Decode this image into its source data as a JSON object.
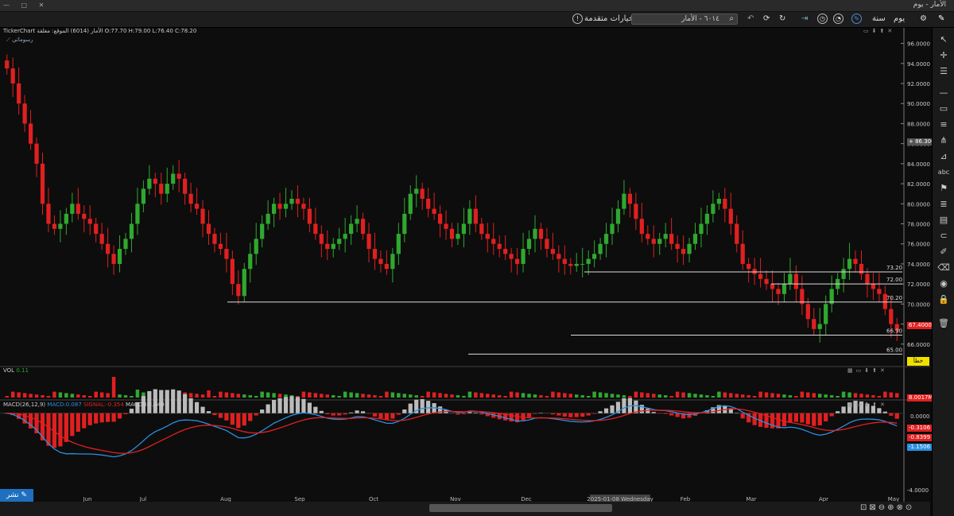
{
  "window": {
    "title": "الأمار - يوم"
  },
  "toolbar": {
    "interval": "يوم",
    "range": "سنة",
    "search_value": "٦٠١٤ - الأمار",
    "advanced": "خيارات متقدمة"
  },
  "chart_header": {
    "info": "TickerChart الأمار (6014) الموقع: مغلقة  O:77.70  H:79.00  L:76.40  C:78.20",
    "drawings": "رسوماتي"
  },
  "vol_header": {
    "label": "VOL",
    "value": "0.11"
  },
  "macd_header": {
    "label": "MACD(26,12,9)",
    "macd": "MACD:0.087",
    "signal": "SIGNAL:-0.354",
    "macdh": "MACDH:0.440"
  },
  "price_axis": [
    "96.0000",
    "94.0000",
    "92.0000",
    "90.0000",
    "88.0000",
    "86.0000",
    "84.0000",
    "82.0000",
    "80.0000",
    "78.0000",
    "76.0000",
    "74.0000",
    "72.0000",
    "70.0000",
    "68.0000",
    "66.0000"
  ],
  "price_tags": {
    "cross": "86.3000",
    "last": "67.4000",
    "vol": "8.0017M",
    "macd1": "-0.3106",
    "macd2": "-0.8399",
    "macd3": "-1.1506",
    "zero": "0.0000",
    "minus4": "-4.0000"
  },
  "levels": [
    {
      "label": "73.20",
      "value": 73.2
    },
    {
      "label": "72.00",
      "value": 72.0
    },
    {
      "label": "70.20",
      "value": 70.2
    },
    {
      "label": "66.90",
      "value": 66.9
    },
    {
      "label": "65.00",
      "value": 65.0
    }
  ],
  "suggest": "خطأ",
  "months": [
    "Jun",
    "Jul",
    "Aug",
    "Sep",
    "Oct",
    "Nov",
    "Dec",
    "2025-01-08 Wednesday",
    "Feb",
    "Mar",
    "Apr",
    "May"
  ],
  "share_button": "نشر",
  "colors": {
    "up": "#2fa82f",
    "down": "#e02020",
    "macd": "#2a8fe0",
    "signal": "#e02020"
  },
  "chart_data": {
    "type": "candlestick",
    "ylim": [
      64.0,
      97.0
    ],
    "close_approx": [
      93.5,
      92,
      90,
      88,
      86,
      84,
      80,
      78,
      77.5,
      78,
      79,
      80,
      79,
      78.5,
      78,
      77,
      76,
      75,
      74,
      75.5,
      76.5,
      78,
      80,
      81.5,
      82.5,
      82,
      81,
      82,
      83,
      82.5,
      81,
      80,
      79.5,
      78,
      77,
      76,
      75.5,
      74.5,
      72,
      70.8,
      73.5,
      75,
      76.5,
      78,
      79,
      80,
      79.5,
      80,
      80.5,
      80,
      79.5,
      78,
      77,
      76,
      75.5,
      76,
      76.5,
      77,
      78,
      78.5,
      77,
      75.5,
      74.5,
      74,
      73.5,
      75,
      77,
      79,
      81,
      81.5,
      80.5,
      79.5,
      79,
      78,
      77.5,
      76.5,
      77,
      78,
      79.5,
      78,
      77,
      76.5,
      76,
      75.5,
      75,
      74.5,
      74,
      75.5,
      76.5,
      77.5,
      76.5,
      75.5,
      75,
      74.5,
      74,
      73.8,
      74,
      74,
      74.5,
      75,
      76,
      77,
      78,
      79.5,
      81,
      80,
      78.5,
      77,
      76.5,
      76,
      76.5,
      77,
      76,
      75.5,
      75,
      76,
      77,
      78,
      79,
      80,
      80.5,
      79.5,
      78,
      76,
      74,
      73.5,
      73,
      72.5,
      72,
      71.5,
      71,
      72,
      73,
      71.5,
      70,
      68.5,
      67.5,
      68,
      70,
      71.5,
      72.5,
      73.5,
      74.5,
      74,
      73,
      72,
      71.5,
      71,
      69.5,
      68,
      67.4
    ],
    "volume_unit": "M",
    "macd_range": [
      -4.5,
      0.5
    ]
  }
}
